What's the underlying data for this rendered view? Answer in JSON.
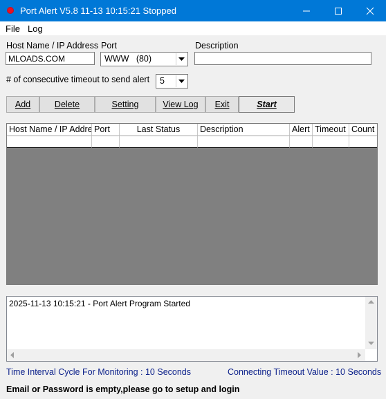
{
  "window": {
    "title": "Port Alert V5.8 11-13 10:15:21 Stopped",
    "accent": "#0078d7",
    "status_dot_color": "#e81123"
  },
  "menu": {
    "items": [
      "File",
      "Log"
    ]
  },
  "form": {
    "host_label": "Host Name / IP Address",
    "host_value": "MLOADS.COM",
    "port_label": "Port",
    "port_value": "WWW   (80)",
    "description_label": "Description",
    "description_value": "",
    "timeout_label": "# of consecutive timeout to send alert",
    "timeout_value": "5"
  },
  "buttons": {
    "add": "Add",
    "delete": "Delete",
    "setting": "Setting",
    "view_log": "View Log",
    "exit": "Exit",
    "start": "Start"
  },
  "table": {
    "columns": [
      "Host Name / IP Addre",
      "Port",
      "Last Status",
      "Description",
      "Alert",
      "Timeout",
      "Count"
    ],
    "background": "#808080"
  },
  "log": {
    "lines": [
      "2025-11-13 10:15:21 - Port Alert Program Started"
    ]
  },
  "status": {
    "interval": "Time Interval Cycle For Monitoring : 10 Seconds",
    "timeout": "Connecting Timeout Value : 10 Seconds",
    "warning": "Email or Password is empty,please go to setup and login",
    "info_color": "#0a1f8a"
  },
  "icons": {
    "minimize": "minimize-icon",
    "maximize": "maximize-icon",
    "close": "close-icon",
    "dropdown": "chevron-down-icon"
  }
}
